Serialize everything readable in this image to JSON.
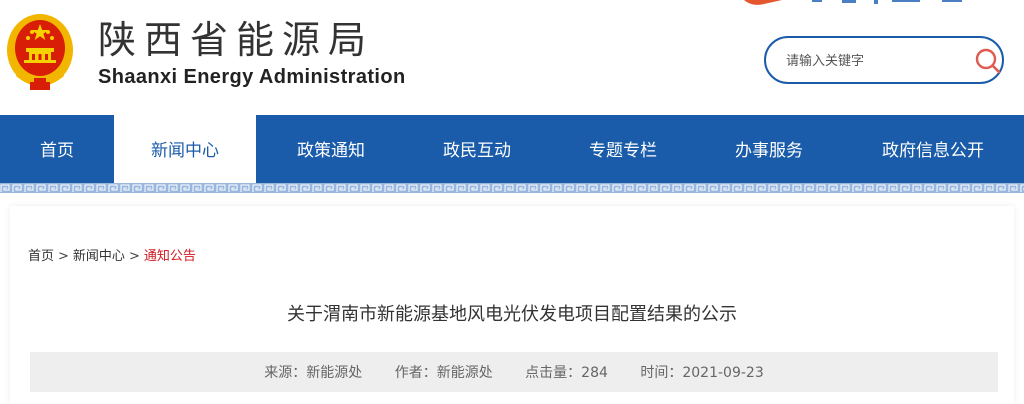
{
  "header": {
    "title_cn": "陕西省能源局",
    "title_en": "Shaanxi Energy Administration",
    "emblem_icon": "national-emblem-icon"
  },
  "search": {
    "placeholder": "请输入关键字",
    "icon": "search-icon"
  },
  "nav": {
    "items": [
      {
        "label": "首页"
      },
      {
        "label": "新闻中心",
        "active": true
      },
      {
        "label": "政策通知"
      },
      {
        "label": "政民互动"
      },
      {
        "label": "专题专栏"
      },
      {
        "label": "办事服务"
      },
      {
        "label": "政府信息公开"
      }
    ]
  },
  "breadcrumb": {
    "items": [
      "首页",
      "新闻中心",
      "通知公告"
    ],
    "separator": ">"
  },
  "article": {
    "title": "关于渭南市新能源基地风电光伏发电项目配置结果的公示",
    "meta": {
      "source_label": "来源：",
      "source": "新能源处",
      "author_label": "作者：",
      "author": "新能源处",
      "clicks_label": "点击量：",
      "clicks": "284",
      "time_label": "时间：",
      "time": "2021-09-23"
    }
  },
  "colors": {
    "brand_blue": "#1a5caa",
    "accent_red": "#d0181f",
    "meta_bg": "#eeeeee"
  }
}
